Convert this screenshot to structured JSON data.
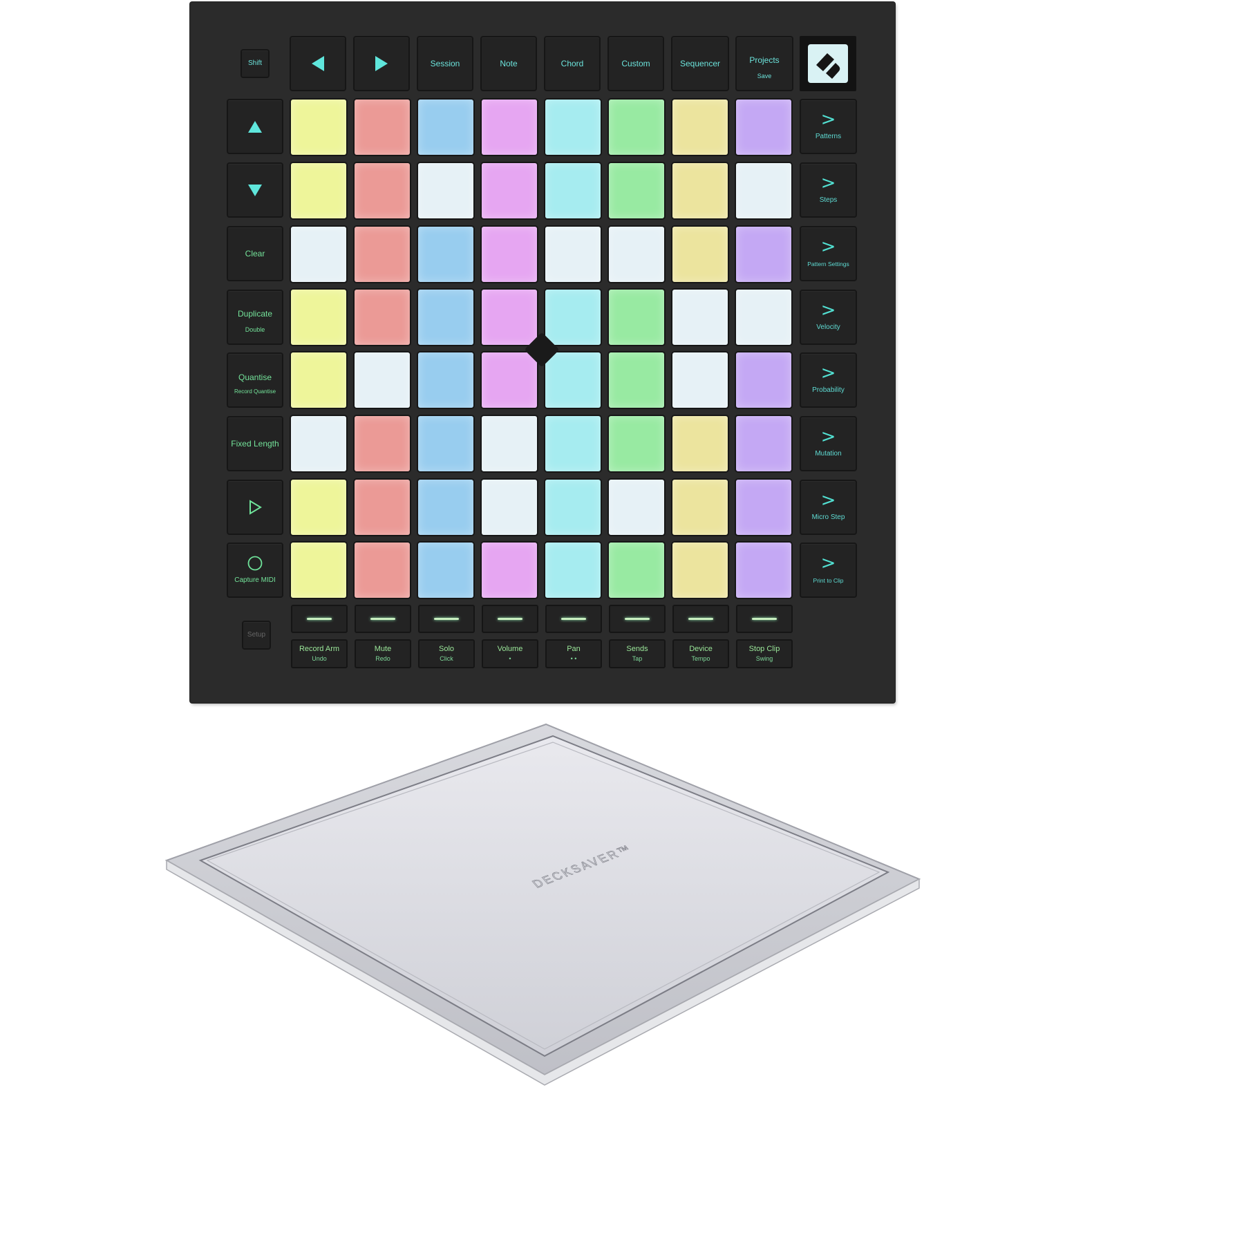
{
  "product": {
    "device": "Grid controller with cover",
    "brand_logo_icon": "novation-logo-icon"
  },
  "top_row": [
    {
      "label": "Shift",
      "icon": null
    },
    {
      "label": "",
      "icon": "arrow-left-icon"
    },
    {
      "label": "",
      "icon": "arrow-right-icon"
    },
    {
      "label": "Session",
      "sub": ""
    },
    {
      "label": "Note",
      "sub": ""
    },
    {
      "label": "Chord",
      "sub": ""
    },
    {
      "label": "Custom",
      "sub": ""
    },
    {
      "label": "Sequencer",
      "sub": ""
    },
    {
      "label": "Projects",
      "sub": "Save"
    }
  ],
  "left_column": [
    {
      "label": "",
      "sub": "",
      "icon": "arrow-up-icon"
    },
    {
      "label": "",
      "sub": "",
      "icon": "arrow-down-icon"
    },
    {
      "label": "Clear",
      "sub": ""
    },
    {
      "label": "Duplicate",
      "sub": "Double"
    },
    {
      "label": "Quantise",
      "sub": "Record Quantise"
    },
    {
      "label": "Fixed Length",
      "sub": ""
    },
    {
      "label": "",
      "sub": "",
      "icon": "play-icon"
    },
    {
      "label": "Capture MIDI",
      "sub": "",
      "icon": "record-icon"
    }
  ],
  "setup_label": "Setup",
  "right_column": [
    {
      "label": "Patterns"
    },
    {
      "label": "Steps"
    },
    {
      "label": "Pattern Settings"
    },
    {
      "label": "Velocity"
    },
    {
      "label": "Probability"
    },
    {
      "label": "Mutation"
    },
    {
      "label": "Micro Step"
    },
    {
      "label": "Print to Clip"
    }
  ],
  "pad_colors": {
    "Y": "#eef59a",
    "R": "#eb9a96",
    "B": "#98cdef",
    "P": "#e6a6f2",
    "C": "#a6ecf0",
    "G": "#98eaa2",
    "K": "#ece49e",
    "V": "#c4a8f4",
    "W": "#e6f1f6"
  },
  "pad_grid": [
    [
      "Y",
      "R",
      "B",
      "P",
      "C",
      "G",
      "K",
      "V"
    ],
    [
      "Y",
      "R",
      "W",
      "P",
      "C",
      "G",
      "K",
      "W"
    ],
    [
      "W",
      "R",
      "B",
      "P",
      "W",
      "W",
      "K",
      "V"
    ],
    [
      "Y",
      "R",
      "B",
      "P",
      "C",
      "G",
      "W",
      "W"
    ],
    [
      "Y",
      "W",
      "B",
      "P",
      "C",
      "G",
      "W",
      "V"
    ],
    [
      "W",
      "R",
      "B",
      "W",
      "C",
      "G",
      "K",
      "V"
    ],
    [
      "Y",
      "R",
      "B",
      "W",
      "C",
      "W",
      "K",
      "V"
    ],
    [
      "Y",
      "R",
      "B",
      "P",
      "C",
      "G",
      "K",
      "V"
    ]
  ],
  "track_strips": [
    {
      "label": "Record Arm",
      "sub": "Undo"
    },
    {
      "label": "Mute",
      "sub": "Redo"
    },
    {
      "label": "Solo",
      "sub": "Click"
    },
    {
      "label": "Volume",
      "sub": "•"
    },
    {
      "label": "Pan",
      "sub": "• •"
    },
    {
      "label": "Sends",
      "sub": "Tap"
    },
    {
      "label": "Device",
      "sub": "Tempo"
    },
    {
      "label": "Stop Clip",
      "sub": "Swing"
    }
  ],
  "cover": {
    "brand_text": "DECKSAVER™"
  }
}
